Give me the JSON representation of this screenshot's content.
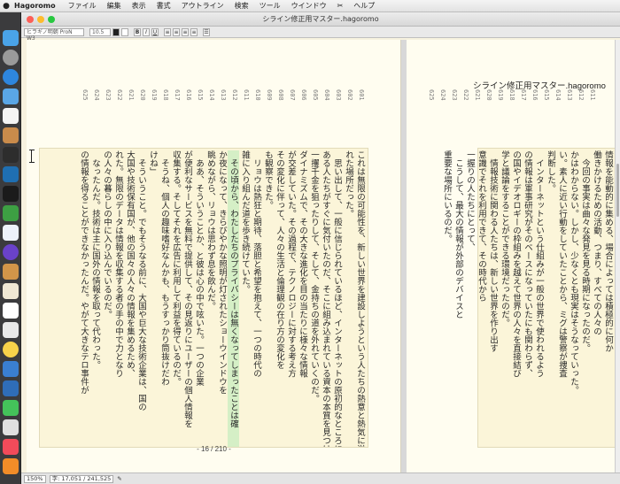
{
  "menubar": {
    "apple": "",
    "app_name": "Hagoromo",
    "items": [
      "ファイル",
      "編集",
      "表示",
      "書式",
      "アウトライン",
      "検索",
      "ツール",
      "ウインドウ",
      "ヘルプ"
    ],
    "extra_icon": "scissors-icon"
  },
  "window": {
    "title": "シライン修正用マスター.hagoromo",
    "toolbar": {
      "font_field": "ヒラギノ明朝 ProN W3",
      "size_field": "10.5",
      "bold": "B",
      "italic": "I",
      "underline": "U"
    }
  },
  "page_left": {
    "line_numbers": [
      "601",
      "602",
      "603",
      "604",
      "605",
      "606",
      "607",
      "608",
      "609",
      "610",
      "611",
      "612",
      "613",
      "614",
      "615",
      "616",
      "617",
      "618",
      "619",
      "620",
      "621",
      "622",
      "623",
      "624",
      "625"
    ],
    "lines": [
      "これは無限の可能性を、新しい世界を建設しようという人たちの熱意と熱気に溢",
      "れた場所だった。",
      "　思い出して、一般に信じられているほど、インターネットの原初的なところにおいて",
      "ある人たちがすぐに気付いたのだ、そこに組み込まれている資本の本質を見つけ、",
      "一攫千金を狙ったりして、そして、金持ちの道を外れていくのだ。",
      "ダイナミズムで、その大きな進化を目の当たりに様々な情報",
      "が交差していた。その過程で、テクノロジーに対する考え方",
      "その変化に伴って、人々の生活と倫理観の在り方の変化を",
      "も観察できた。",
      "　リョウは熱狂と期待、落胆と希望を抱えて、一つの時代の",
      "雑に入り組んだ道を歩き続けていた。",
      "　その頃から、わたしたちのプライバシーは無くなってしまったことは確",
      "か夜になって、きらびやかな照明が灯されたショーウインドウを",
      "眺めながら、リョウは思わず息を飲んだ。",
      "　ああ、そういうことか、と彼は心の中で呟いた。一つの企業",
      "が便利なサービスを無料で提供して、その見返りにユーザーの個人情報を",
      "収集する。そしてそれを広告に利用して利益を得ているのだ。",
      "　そうね、個人の趣味嗜好なんかも、もうすっかり筒抜けだわ",
      "けね」",
      "　そういうこと。でもそうなる前に、大国や巨大な技術企業は、国の",
      "大国や技術保有国が、他の国々の人々の情報を集めるため、",
      "れた。無限のデータは情報を収集する者の手の中で力となり",
      "の人々の暮らしの中に入り込んでいるのだ。",
      "　なったんだ。技術は主に国外の情報を取って代わった。",
      "の情報を得ることができなかったんだ。やがて大きなテロ事件が"
    ],
    "highlight_index": 11,
    "page_number": "- 16 / 210 -"
  },
  "page_right": {
    "title": "シライン修正用マスター.hagoromo",
    "line_numbers": [
      "611",
      "612",
      "613",
      "614",
      "615",
      "616",
      "617",
      "618",
      "619",
      "620",
      "621",
      "622",
      "623",
      "624",
      "625"
    ],
    "lines": [
      "情報を能動的に集める、場合によっては積極的に何か",
      "働きかけるための活動、つまり、すべての人々の",
      "　今回の事実は曲々な発見を見る時期になったのだ。",
      "かはわからない。しかし、少なくとも現実はそうなっていった。",
      "い。素人に近い行動をしていたことから、ミグは警察が捜査",
      "判断した。",
      "　インターネットという仕組みが一般の世界で使われるよう",
      "の情報は軍事研究がそのベースになっていたにも関わらず、",
      "の国やイデオロギーの枠組みを越えて世界の人々を直接結び",
      "学と議論をすることができる環境だったのだ。",
      "　情報技術に関わる人たちは、新しい世界を作り出す",
      "意識でそれを利用できて、その時代から",
      "一握りの人たちにとって、",
      "　こうして、最大の情報が外部のデバイスと",
      "重要な場所にいるのだ。"
    ]
  },
  "statusbar": {
    "zoom": "150%",
    "position": "字: 17,051 / 241,525"
  }
}
